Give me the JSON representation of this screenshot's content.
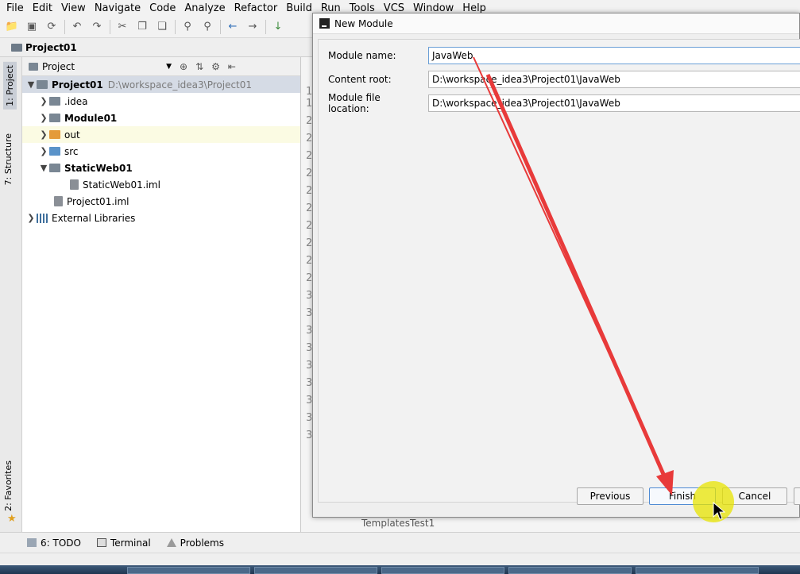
{
  "menu": [
    "File",
    "Edit",
    "View",
    "Navigate",
    "Code",
    "Analyze",
    "Refactor",
    "Build",
    "Run",
    "Tools",
    "VCS",
    "Window",
    "Help"
  ],
  "navbar": {
    "crumb": "Project01"
  },
  "left_strip": {
    "project_tab": "1: Project",
    "structure_tab": "7: Structure",
    "favorites_tab": "2: Favorites"
  },
  "project_panel": {
    "view_selector": "Project",
    "tree": [
      {
        "name": "Project01",
        "path": "D:\\workspace_idea3\\Project01"
      },
      {
        "name": ".idea"
      },
      {
        "name": "Module01"
      },
      {
        "name": "out"
      },
      {
        "name": "src"
      },
      {
        "name": "StaticWeb01"
      },
      {
        "name": "StaticWeb01.iml"
      },
      {
        "name": "Project01.iml"
      },
      {
        "name": "External Libraries"
      }
    ]
  },
  "gutter": [
    "1",
    "1",
    "2",
    "2",
    "2",
    "2",
    "2",
    "2",
    "2",
    "2",
    "2",
    "2",
    "3",
    "3",
    "3",
    "3",
    "3",
    "3",
    "3",
    "3",
    "3"
  ],
  "dialog": {
    "title": "New Module",
    "module_name_label": "Module name:",
    "module_name_value": "JavaWeb",
    "content_root_label": "Content root:",
    "content_root_value": "D:\\workspace_idea3\\Project01\\JavaWeb",
    "file_location_label": "Module file location:",
    "file_location_value": "D:\\workspace_idea3\\Project01\\JavaWeb",
    "previous_button": "Previous",
    "finish_button": "Finish",
    "cancel_button": "Cancel"
  },
  "editor_bottom_text": "TemplatesTest1",
  "bottom_tabs": {
    "todo": "6: TODO",
    "terminal": "Terminal",
    "problems": "Problems"
  },
  "colors": {
    "annotation_arrow": "#e83a3a",
    "click_highlight": "#e8e400",
    "folder_orange": "#e49b3a",
    "folder_blue": "#5a93c9"
  }
}
